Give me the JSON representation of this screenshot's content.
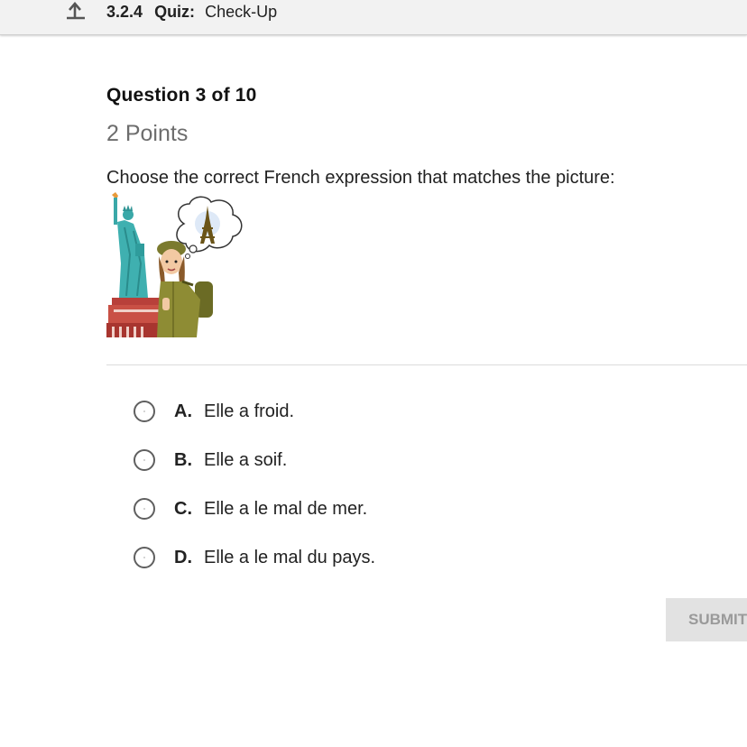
{
  "header": {
    "back_icon": "back-arrow-icon",
    "quiz_number": "3.2.4",
    "quiz_label": "Quiz:",
    "quiz_name": "Check-Up"
  },
  "question": {
    "number_text": "Question 3 of 10",
    "points_text": "2 Points",
    "prompt": "Choose the correct French expression that matches the picture:",
    "image_description_icon": "statue-of-liberty-girl-thinking-eiffel-tower-illustration"
  },
  "options": [
    {
      "letter": "A.",
      "text": "Elle a froid.",
      "selected": false
    },
    {
      "letter": "B.",
      "text": "Elle a soif.",
      "selected": false
    },
    {
      "letter": "C.",
      "text": "Elle a le mal de mer.",
      "selected": false
    },
    {
      "letter": "D.",
      "text": "Elle a le mal du pays.",
      "selected": false
    }
  ],
  "submit": {
    "label": "SUBMIT",
    "enabled": false
  },
  "colors": {
    "header_bg": "#f2f2f2",
    "points_text": "#6d6d6d",
    "submit_bg": "#e2e2e2",
    "submit_text": "#9a9a9a"
  }
}
